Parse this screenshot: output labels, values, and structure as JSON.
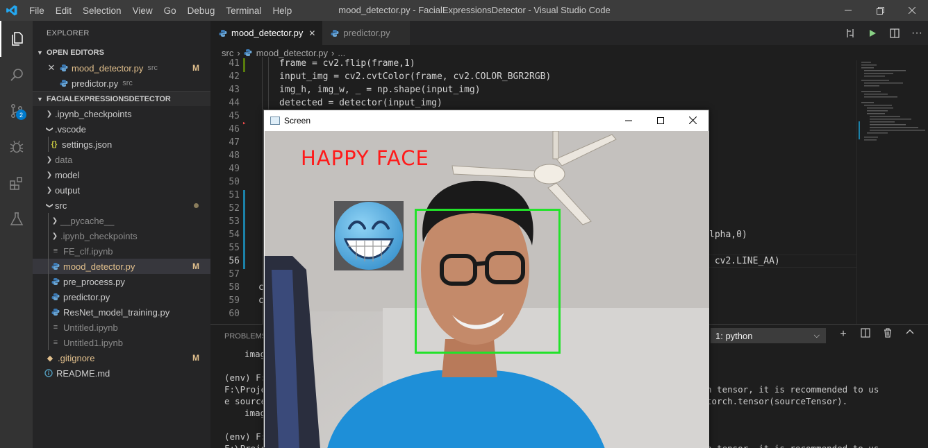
{
  "titlebar": {
    "menu": [
      "File",
      "Edit",
      "Selection",
      "View",
      "Go",
      "Debug",
      "Terminal",
      "Help"
    ],
    "title": "mood_detector.py - FacialExpressionsDetector - Visual Studio Code"
  },
  "activity": {
    "scm_badge": "2"
  },
  "sidebar": {
    "title": "EXPLORER",
    "open_editors_header": "OPEN EDITORS",
    "open_editors": [
      {
        "name": "mood_detector.py",
        "desc": "src",
        "status": "M"
      },
      {
        "name": "predictor.py",
        "desc": "src"
      }
    ],
    "project_header": "FACIALEXPRESSIONSDETECTOR",
    "tree": [
      {
        "label": ".ipynb_checkpoints"
      },
      {
        "label": ".vscode"
      },
      {
        "label": "settings.json"
      },
      {
        "label": "data"
      },
      {
        "label": "model"
      },
      {
        "label": "output"
      },
      {
        "label": "src"
      },
      {
        "label": "__pycache__"
      },
      {
        "label": ".ipynb_checkpoints"
      },
      {
        "label": "FE_clf.ipynb"
      },
      {
        "label": "mood_detector.py",
        "status": "M"
      },
      {
        "label": "pre_process.py"
      },
      {
        "label": "predictor.py"
      },
      {
        "label": "ResNet_model_training.py"
      },
      {
        "label": "Untitled.ipynb"
      },
      {
        "label": "Untitled1.ipynb"
      },
      {
        "label": ".gitignore",
        "status": "M"
      },
      {
        "label": "README.md"
      }
    ]
  },
  "tabs": [
    {
      "label": "mood_detector.py",
      "active": true
    },
    {
      "label": "predictor.py",
      "active": false
    }
  ],
  "breadcrumb": [
    "src",
    "mood_detector.py",
    "..."
  ],
  "code": {
    "line_numbers": [
      "41",
      "42",
      "43",
      "44",
      "45",
      "46",
      "47",
      "48",
      "49",
      "50",
      "51",
      "52",
      "53",
      "54",
      "55",
      "56",
      "57",
      "58",
      "59",
      "60"
    ],
    "lines": {
      "l41": "frame = cv2.flip(frame,1)",
      "l42": "input_img = cv2.cvtColor(frame, cv2.COLOR_BGR2RGB)",
      "l43": "img_h, img_w, _ = np.shape(input_img)",
      "l44": "detected = detector(input_img)",
      "l54_tail": "lpha,0)",
      "l56_tail": " cv2.LINE_AA)",
      "l58_head": "c",
      "l59_head": "c"
    }
  },
  "panel": {
    "tab": "PROBLEMS",
    "terminal_select": "1: python",
    "lines": [
      "  image",
      "",
      "(env) F:",
      "F:\\Proje",
      "e source",
      "  image",
      "",
      "(env) F:",
      "F:\\Proje"
    ],
    "right_lines": [
      "n tensor, it is recommended to us",
      "torch.tensor(sourceTensor).",
      "n tensor, it is recommended to us"
    ]
  },
  "screen_window": {
    "title": "Screen",
    "label": "HAPPY FACE"
  },
  "colors": {
    "accent": "#007acc",
    "modified": "#e2c08d",
    "label_red": "#ff1a1a",
    "box_green": "#22e22a"
  }
}
